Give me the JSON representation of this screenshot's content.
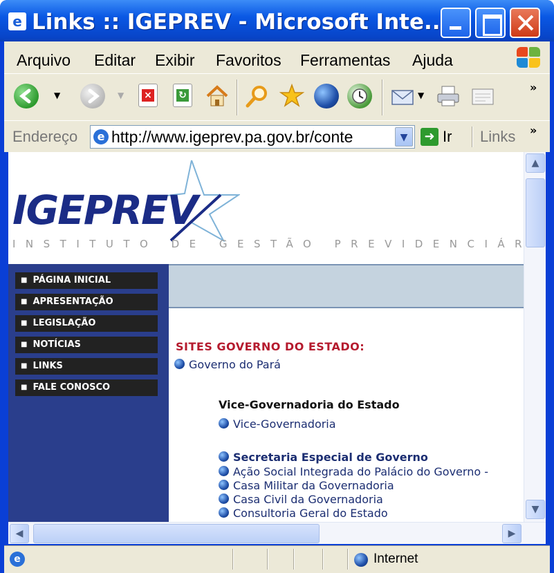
{
  "window": {
    "title": "Links :: IGEPREV - Microsoft Inte...",
    "app_icon": "ie-page-icon"
  },
  "menu": {
    "items": [
      "Arquivo",
      "Editar",
      "Exibir",
      "Favoritos",
      "Ferramentas",
      "Ajuda"
    ]
  },
  "toolbar": {
    "icons": [
      "back-icon",
      "forward-icon",
      "stop-icon",
      "refresh-icon",
      "home-icon",
      "search-icon",
      "favorites-icon",
      "media-icon",
      "history-icon",
      "mail-icon",
      "print-icon",
      "edit-icon"
    ],
    "more": "»"
  },
  "address": {
    "label": "Endereço",
    "url": "http://www.igeprev.pa.gov.br/conte",
    "go_label": "Ir",
    "links_label": "Links",
    "more": "»"
  },
  "site": {
    "logo": "IGEPREV",
    "subtitle": "INSTITUTO DE GESTÃO PREVIDENCIÁR"
  },
  "nav": [
    "PÁGINA INICIAL",
    "APRESENTAÇÃO",
    "LEGISLAÇÃO",
    "NOTÍCIAS",
    "LINKS",
    "FALE CONOSCO"
  ],
  "content": {
    "section_title": "SITES GOVERNO DO ESTADO:",
    "gov_link": "Governo do Pará",
    "vice_heading": "Vice-Governadoria do Estado",
    "vice_link": "Vice-Governadoria",
    "secretaria_link": "Secretaria Especial de Governo",
    "links": [
      "Ação Social Integrada do Palácio do Governo -",
      "Casa Militar da Governadoria",
      "Casa Civil da Governadoria",
      "Consultoria Geral do Estado"
    ]
  },
  "status": {
    "zone": "Internet"
  },
  "colors": {
    "titlebar": "#0a58e4",
    "sidebar": "#2a3e8c",
    "section_title": "#b51b2e",
    "link": "#1c2e72"
  }
}
